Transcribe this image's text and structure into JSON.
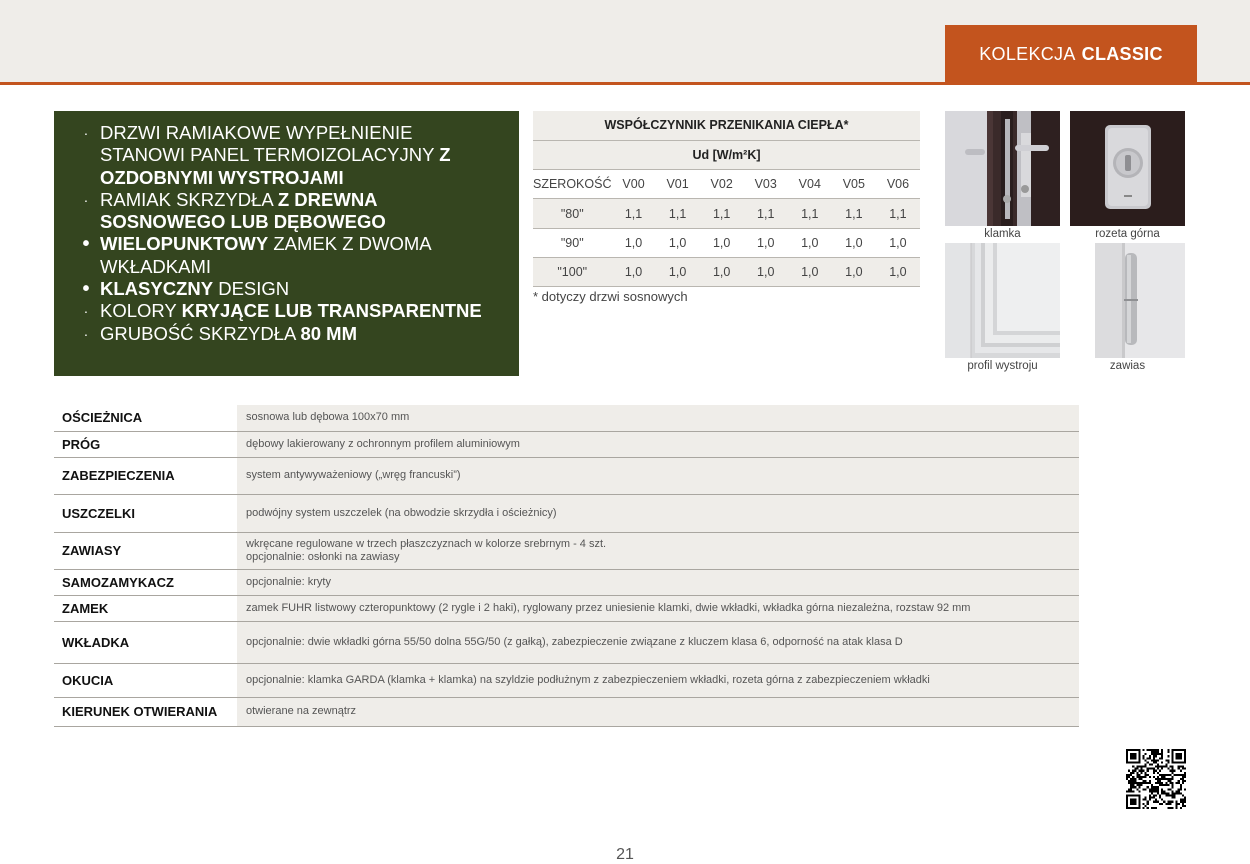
{
  "header": {
    "collection_prefix": "KOLEKCJA",
    "collection_name": "CLASSIC",
    "accent_color": "#c3541e",
    "band_color": "#efede9"
  },
  "features": {
    "panel_color": "#34451f",
    "items": [
      {
        "bullet": "·",
        "normal": "DRZWI RAMIAKOWE WYPEŁNIENIE STANOWI PANEL TERMOIZOLACYJNY ",
        "bold": "Z OZDOBNYMI WYSTROJAMI",
        "after": ""
      },
      {
        "bullet": "·",
        "normal": "RAMIAK SKRZYDŁA ",
        "bold": "Z DREWNA SOSNOWEGO LUB DĘBOWEGO",
        "after": ""
      },
      {
        "bullet": "•",
        "normal": "",
        "bold": "WIELOPUNKTOWY",
        "after": " ZAMEK Z DWOMA WKŁADKAMI"
      },
      {
        "bullet": "•",
        "normal": "",
        "bold": "KLASYCZNY",
        "after": " DESIGN"
      },
      {
        "bullet": "·",
        "normal": "KOLORY ",
        "bold": "KRYJĄCE LUB TRANSPARENTNE",
        "after": ""
      },
      {
        "bullet": "·",
        "normal": "GRUBOŚĆ SKRZYDŁA ",
        "bold": "80 MM",
        "after": ""
      }
    ]
  },
  "heat_table": {
    "title": "WSPÓŁCZYNNIK PRZENIKANIA CIEPŁA*",
    "unit": "Ud [W/m²K]",
    "columns": [
      "SZEROKOŚĆ",
      "V00",
      "V01",
      "V02",
      "V03",
      "V04",
      "V05",
      "V06"
    ],
    "rows": [
      [
        "\"80\"",
        "1,1",
        "1,1",
        "1,1",
        "1,1",
        "1,1",
        "1,1",
        "1,1"
      ],
      [
        "\"90\"",
        "1,0",
        "1,0",
        "1,0",
        "1,0",
        "1,0",
        "1,0",
        "1,0"
      ],
      [
        "\"100\"",
        "1,0",
        "1,0",
        "1,0",
        "1,0",
        "1,0",
        "1,0",
        "1,0"
      ]
    ],
    "note": "* dotyczy drzwi sosnowych"
  },
  "thumbnails": [
    {
      "label": "klamka",
      "icon": "door-handle-photo"
    },
    {
      "label": "rozeta górna",
      "icon": "lock-rosette-photo"
    },
    {
      "label": "profil wystroju",
      "icon": "panel-profile-photo"
    },
    {
      "label": "zawias",
      "icon": "hinge-photo"
    }
  ],
  "specs": [
    {
      "label": "OŚCIEŻNICA",
      "value": "sosnowa lub dębowa 100x70 mm",
      "value2": ""
    },
    {
      "label": "PRÓG",
      "value": "dębowy lakierowany z ochronnym profilem aluminiowym",
      "value2": ""
    },
    {
      "label": "ZABEZPIECZENIA",
      "value": "system antywyważeniowy („wręg francuski”)",
      "value2": ""
    },
    {
      "label": "USZCZELKI",
      "value": "podwójny system uszczelek (na obwodzie skrzydła i ościeżnicy)",
      "value2": ""
    },
    {
      "label": "ZAWIASY",
      "value": "wkręcane regulowane w trzech płaszczyznach w kolorze srebrnym - 4 szt.",
      "value2": "opcjonalnie: osłonki na zawiasy"
    },
    {
      "label": "SAMOZAMYKACZ",
      "value": "opcjonalnie: kryty",
      "value2": ""
    },
    {
      "label": "ZAMEK",
      "value": "zamek FUHR listwowy czteropunktowy (2 rygle i 2 haki), ryglowany przez uniesienie klamki, dwie wkładki, wkładka górna niezależna, rozstaw 92 mm",
      "value2": ""
    },
    {
      "label": "WKŁADKA",
      "value": "opcjonalnie: dwie wkładki górna 55/50 dolna 55G/50 (z gałką), zabezpieczenie związane z kluczem klasa 6, odporność na atak klasa D",
      "value2": ""
    },
    {
      "label": "OKUCIA",
      "value": "opcjonalnie: klamka GARDA (klamka + klamka) na szyldzie podłużnym z zabezpieczeniem wkładki, rozeta górna z zabezpieczeniem wkładki",
      "value2": ""
    },
    {
      "label": "KIERUNEK OTWIERANIA",
      "value": "otwierane na zewnątrz",
      "value2": ""
    }
  ],
  "qr_icon": "qr-code-icon",
  "page_number": "21"
}
